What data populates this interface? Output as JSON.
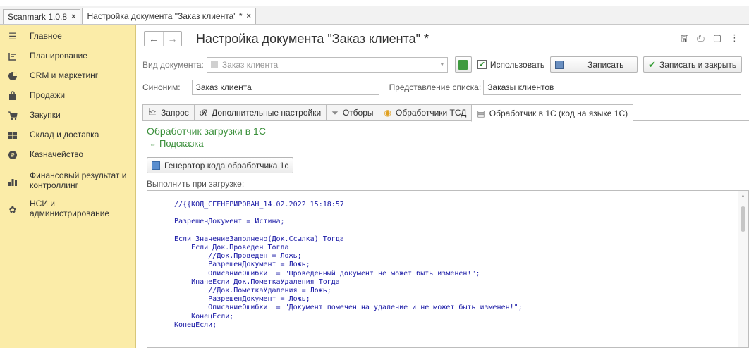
{
  "window_tabs": [
    {
      "label": "Scanmark 1.0.8"
    },
    {
      "label": "Настройка документа \"Заказ клиента\" *"
    }
  ],
  "sidebar": {
    "items": [
      {
        "label": "Главное",
        "icon": "menu-lines-icon"
      },
      {
        "label": "Планирование",
        "icon": "planning-icon"
      },
      {
        "label": "CRM и маркетинг",
        "icon": "crm-pie-icon"
      },
      {
        "label": "Продажи",
        "icon": "bag-icon"
      },
      {
        "label": "Закупки",
        "icon": "cart-icon"
      },
      {
        "label": "Склад и доставка",
        "icon": "warehouse-icon"
      },
      {
        "label": "Казначейство",
        "icon": "coin-icon"
      },
      {
        "label": "Финансовый результат и контроллинг",
        "icon": "bar-chart-icon"
      },
      {
        "label": "НСИ и администрирование",
        "icon": "gear-icon"
      }
    ]
  },
  "header": {
    "title": "Настройка документа \"Заказ клиента\" *"
  },
  "form": {
    "doc_type_label": "Вид документа:",
    "doc_type_value": "Заказ клиента",
    "use_label": "Использовать",
    "save_label": "Записать",
    "save_close_label": "Записать и закрыть",
    "synonym_label": "Синоним:",
    "synonym_value": "Заказ клиента",
    "list_repr_label": "Представление списка:",
    "list_repr_value": "Заказы клиентов"
  },
  "tabs": [
    {
      "label": "Запрос"
    },
    {
      "label": "Дополнительные настройки"
    },
    {
      "label": "Отборы"
    },
    {
      "label": "Обработчики ТСД"
    },
    {
      "label": "Обработчик в 1С (код на языке 1С)"
    }
  ],
  "handler": {
    "title": "Обработчик загрузки в 1С",
    "hint": "Подсказка",
    "generator_label": "Генератор кода обработчика 1с",
    "exec_label": "Выполнить при загрузке:",
    "code": "//{{КОД_СГЕНЕРИРОВАН_14.02.2022 15:18:57\n\nРазрешенДокумент = Истина;\n\nЕсли ЗначениеЗаполнено(Док.Ссылка) Тогда\n    Если Док.Проведен Тогда\n        //Док.Проведен = Ложь;\n        РазрешенДокумент = Ложь;\n        ОписаниеОшибки  = \"Проведенный документ не может быть изменен!\";\n    ИначеЕсли Док.ПометкаУдаления Тогда\n        //Док.ПометкаУдаления = Ложь;\n        РазрешенДокумент = Ложь;\n        ОписаниеОшибки  = \"Документ помечен на удаление и не может быть изменен!\";\n    КонецЕсли;\nКонецЕсли;"
  }
}
